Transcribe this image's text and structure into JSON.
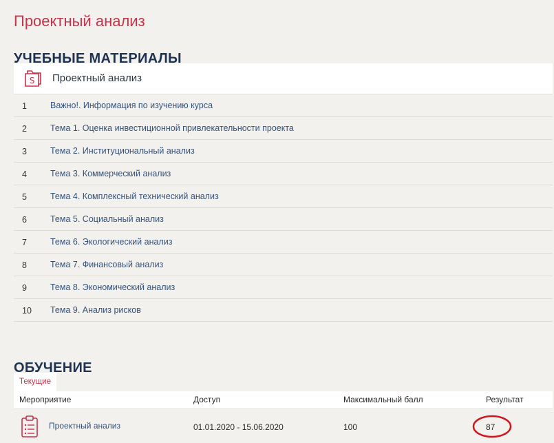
{
  "page": {
    "title": "Проектный анализ"
  },
  "materials": {
    "heading": "УЧЕБНЫЕ МАТЕРИАЛЫ",
    "course_name": "Проектный анализ",
    "course_icon": "document-s-icon",
    "items": [
      {
        "num": "1",
        "label": "Важно!. Информация по изучению курса"
      },
      {
        "num": "2",
        "label": "Тема 1. Оценка инвестиционной привлекательности проекта"
      },
      {
        "num": "3",
        "label": "Тема 2. Институциональный анализ"
      },
      {
        "num": "4",
        "label": "Тема 3. Коммерческий анализ"
      },
      {
        "num": "5",
        "label": "Тема 4. Комплексный технический анализ"
      },
      {
        "num": "6",
        "label": "Тема 5. Социальный анализ"
      },
      {
        "num": "7",
        "label": "Тема 6. Экологический анализ"
      },
      {
        "num": "8",
        "label": "Тема 7. Финансовый анализ"
      },
      {
        "num": "9",
        "label": "Тема 8. Экономический анализ"
      },
      {
        "num": "10",
        "label": "Тема 9. Анализ рисков"
      }
    ]
  },
  "training": {
    "heading": "ОБУЧЕНИЕ",
    "tab_current": "Текущие",
    "columns": {
      "event": "Мероприятие",
      "access": "Доступ",
      "max_score": "Максимальный балл",
      "result": "Результат"
    },
    "rows": [
      {
        "event": "Проектный анализ",
        "access": "01.01.2020 - 15.06.2020",
        "max_score": "100",
        "result": "87",
        "icon": "clipboard-list-icon"
      }
    ]
  },
  "colors": {
    "accent": "#c8324a",
    "heading": "#1e3350",
    "link": "#34527a",
    "background": "#f3f1ee",
    "annotation": "#d0141c"
  }
}
